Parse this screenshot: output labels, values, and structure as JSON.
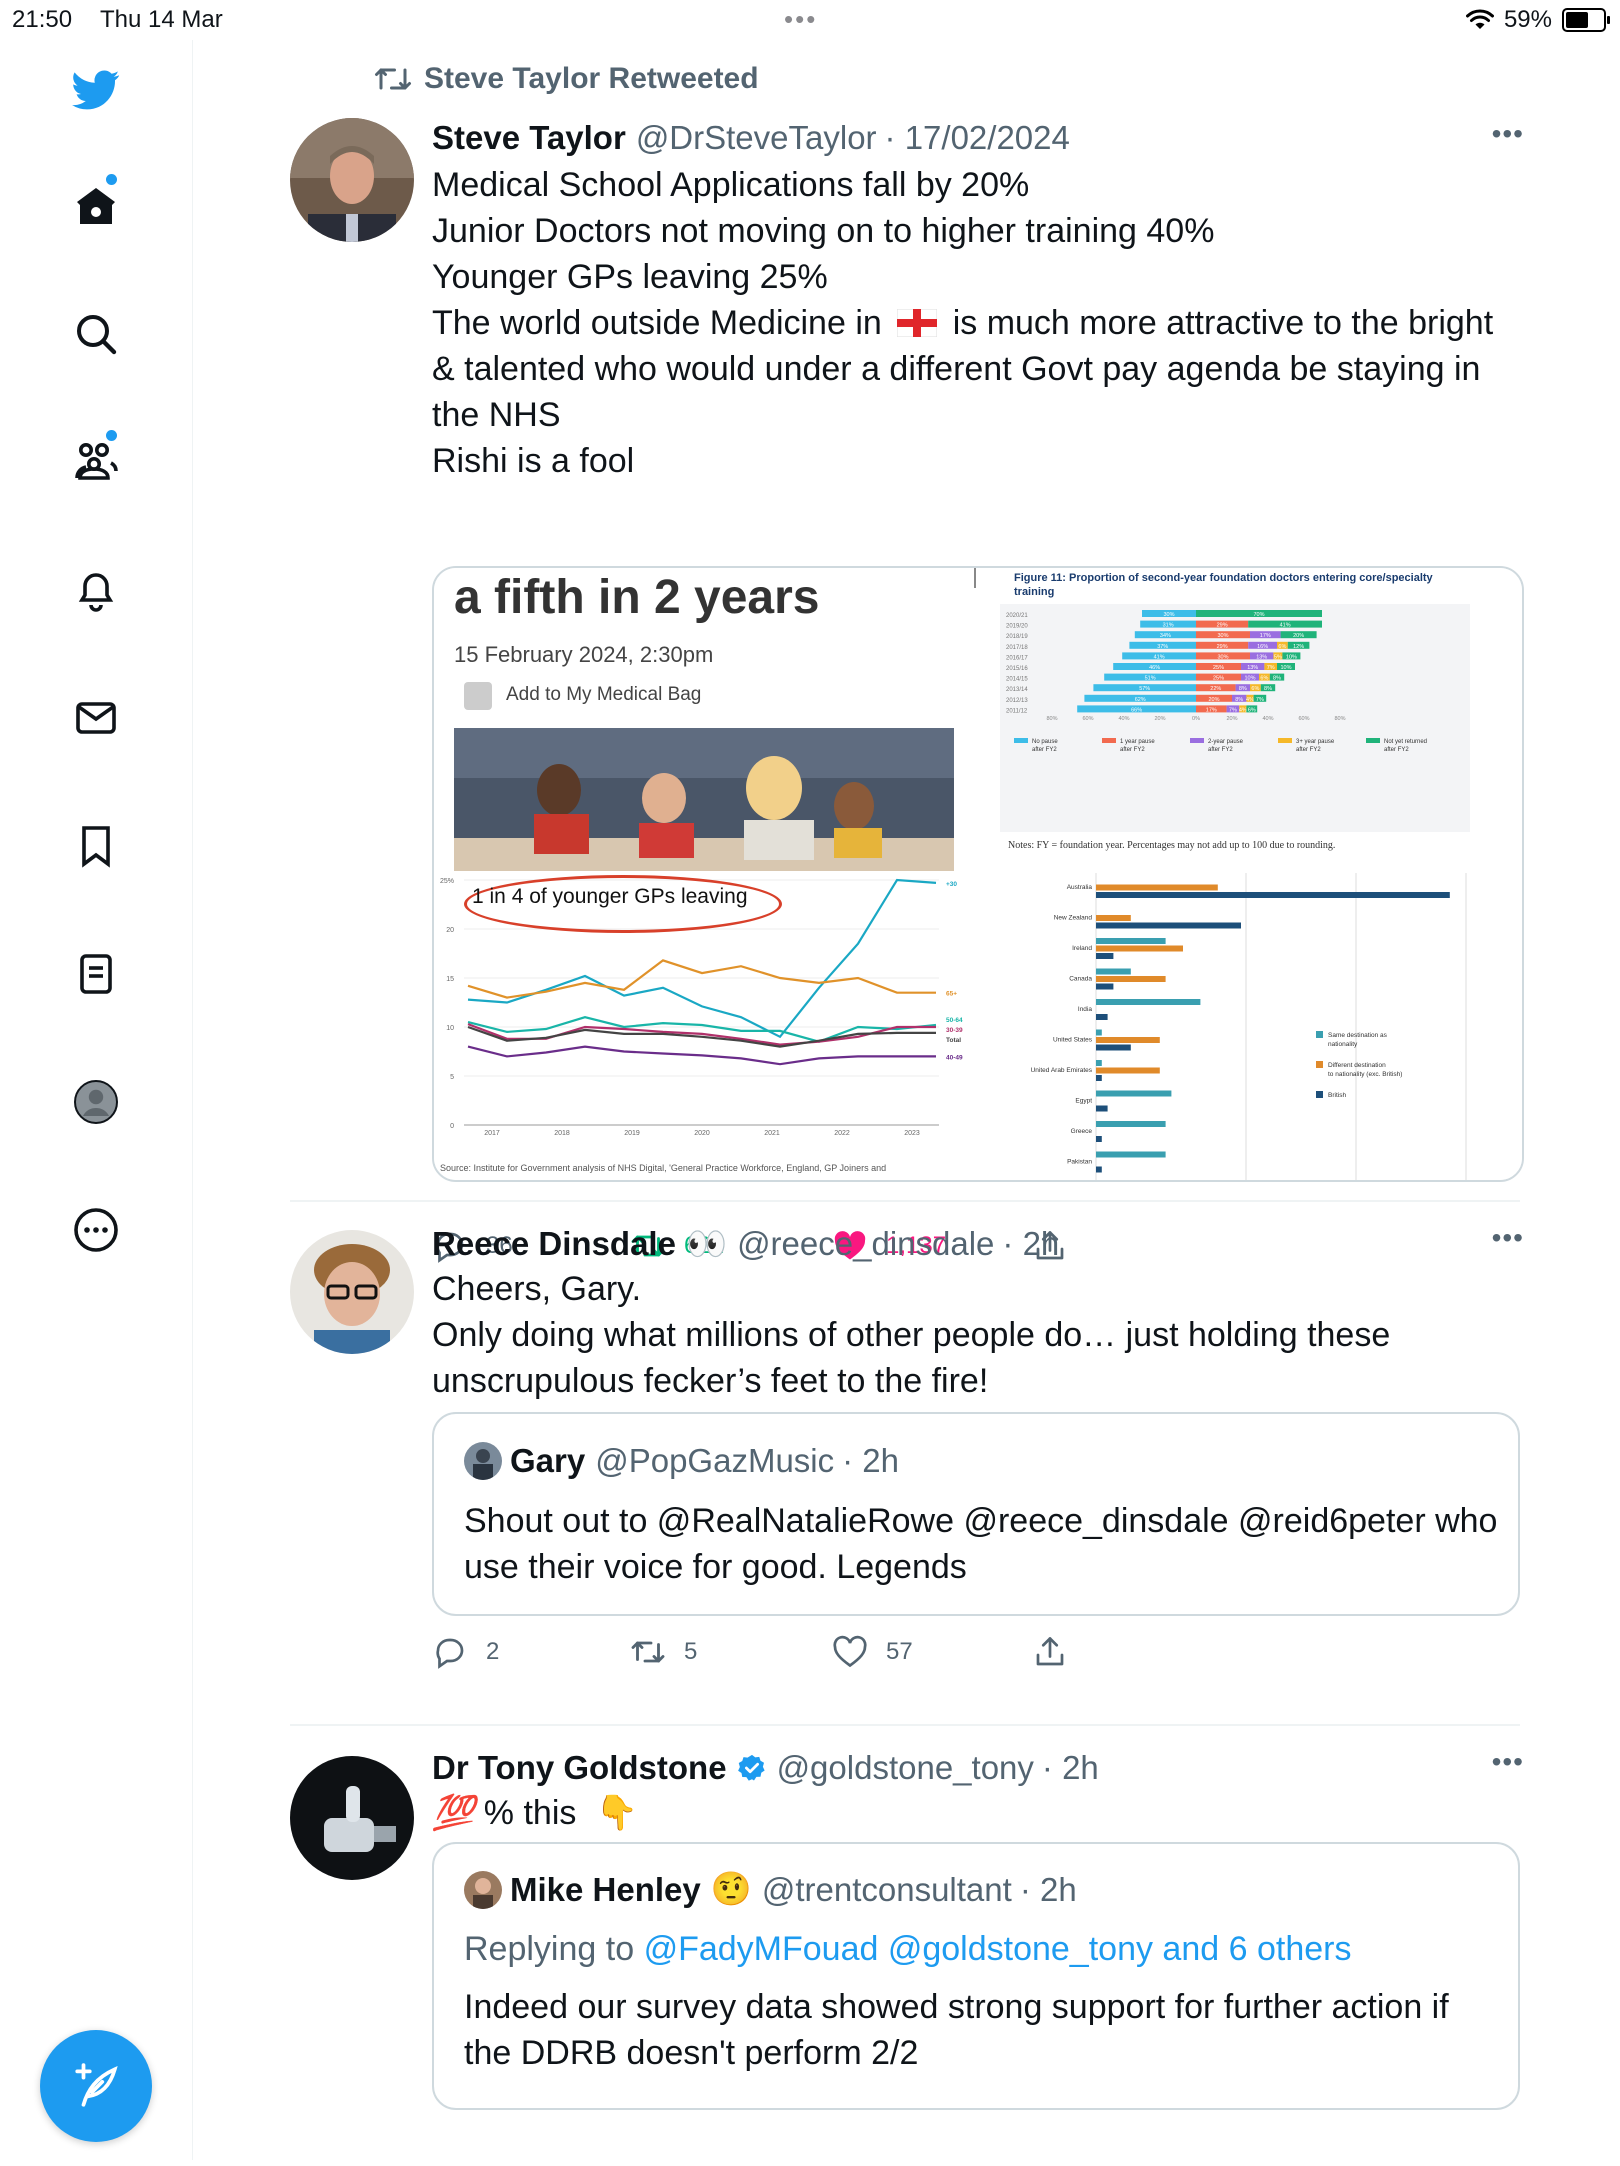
{
  "status_bar": {
    "time": "21:50",
    "date": "Thu 14 Mar",
    "dots": "•••",
    "battery": "59%"
  },
  "colors": {
    "accent": "#1d9bf0",
    "retweet": "#00ba7c",
    "like": "#f91880",
    "secondary": "#536471"
  },
  "sidebar": {
    "icons": [
      "twitter-logo-icon",
      "home-icon",
      "search-icon",
      "communities-icon",
      "notifications-icon",
      "messages-icon",
      "bookmarks-icon",
      "lists-icon",
      "profile-icon",
      "more-icon"
    ]
  },
  "tweets": [
    {
      "retweeted_by": "Steve Taylor Retweeted",
      "name": "Steve Taylor",
      "handle": "@DrSteveTaylor",
      "time": "· 17/02/2024",
      "lines": [
        "Medical School Applications fall by 20%",
        "Junior Doctors not moving on to higher training 40%",
        "Younger GPs leaving 25%",
        "The world outside Medicine in",
        "is much more attractive to the bright",
        "& talented who would under a different Govt pay agenda be staying in",
        "the NHS",
        "Rishi is a fool"
      ],
      "media": {
        "article_heading": "a fifth in 2 years",
        "article_date": "15 February 2024, 2:30pm",
        "article_action": "Add to My Medical Bag",
        "figure_title": "Figure 11: Proportion of second-year foundation doctors entering core/specialty",
        "figure_title_2": "training",
        "figure_notes": "Notes: FY = foundation year. Percentages may not add up to 100 due to rounding.",
        "gp_chart_label": "1 in 4 of younger GPs leaving",
        "gp_chart_source": "Source: Institute for Government analysis of NHS Digital, 'General Practice Workforce, England, GP Joiners and",
        "fig_rows": [
          {
            "year": "2020/21",
            "no_pause": 30,
            "one_year": 0,
            "two_year": 0,
            "three_year": 0,
            "not_returned": 70
          },
          {
            "year": "2019/20",
            "no_pause": 31,
            "one_year": 29,
            "two_year": 0,
            "three_year": 0,
            "not_returned": 41
          },
          {
            "year": "2018/19",
            "no_pause": 34,
            "one_year": 30,
            "two_year": 17,
            "three_year": 0,
            "not_returned": 20
          },
          {
            "year": "2017/18",
            "no_pause": 37,
            "one_year": 29,
            "two_year": 16,
            "three_year": 6,
            "not_returned": 12
          },
          {
            "year": "2016/17",
            "no_pause": 41,
            "one_year": 30,
            "two_year": 13,
            "three_year": 5,
            "not_returned": 10
          },
          {
            "year": "2015/16",
            "no_pause": 46,
            "one_year": 25,
            "two_year": 13,
            "three_year": 7,
            "not_returned": 10
          },
          {
            "year": "2014/15",
            "no_pause": 51,
            "one_year": 25,
            "two_year": 10,
            "three_year": 6,
            "not_returned": 8
          },
          {
            "year": "2013/14",
            "no_pause": 57,
            "one_year": 22,
            "two_year": 8,
            "three_year": 6,
            "not_returned": 8
          },
          {
            "year": "2012/13",
            "no_pause": 62,
            "one_year": 20,
            "two_year": 8,
            "three_year": 4,
            "not_returned": 7
          },
          {
            "year": "2011/12",
            "no_pause": 66,
            "one_year": 17,
            "two_year": 7,
            "three_year": 4,
            "not_returned": 6
          }
        ],
        "fig_axis": [
          "80%",
          "60%",
          "40%",
          "20%",
          "0%",
          "20%",
          "40%",
          "60%",
          "80%"
        ],
        "fig_legend": [
          {
            "label": "No pause after FY2",
            "color": "#3dbde8"
          },
          {
            "label": "1 year pause after FY2",
            "color": "#f26a4f"
          },
          {
            "label": "2-year pause after FY2",
            "color": "#9a6ee0"
          },
          {
            "label": "3+ year pause after FY2",
            "color": "#f5b829"
          },
          {
            "label": "Not yet returned after FY2",
            "color": "#1fb37a"
          }
        ],
        "gp_years": [
          "2017",
          "2018",
          "2019",
          "2020",
          "2021",
          "2022",
          "2023"
        ],
        "gp_yticks": [
          "25%",
          "20",
          "15",
          "10",
          "5",
          "0"
        ],
        "gp_series": [
          {
            "name": "+30",
            "color": "#1aa8c4",
            "values": [
              12.8,
              12.5,
              13.8,
              15.2,
              13.2,
              14,
              12.1,
              11,
              9,
              14,
              18.5,
              25,
              24.7
            ]
          },
          {
            "name": "65+",
            "color": "#e0922a",
            "values": [
              14.2,
              13,
              13.6,
              14.5,
              13.8,
              16.8,
              15.5,
              16.2,
              15,
              14.5,
              15,
              13.5,
              13.5
            ]
          },
          {
            "name": "50-64",
            "color": "#19b5a8",
            "values": [
              10.5,
              9.5,
              9.8,
              11,
              10,
              10.4,
              10.2,
              9.6,
              9.6,
              8.5,
              10,
              9.8,
              10.2
            ]
          },
          {
            "name": "30-39",
            "color": "#b0306a",
            "values": [
              10.3,
              8.8,
              8.8,
              10,
              9.8,
              9.5,
              9.3,
              8.8,
              8.2,
              8.5,
              9,
              10,
              10
            ]
          },
          {
            "name": "Total",
            "color": "#444444",
            "values": [
              10,
              8.6,
              8.9,
              9.7,
              9.3,
              9.3,
              9,
              8.6,
              8,
              8.6,
              9.3,
              9.4,
              9.4
            ]
          },
          {
            "name": "40-49",
            "color": "#6a2d8a",
            "values": [
              8,
              7,
              7.4,
              8,
              7.5,
              7.3,
              7.1,
              6.8,
              6.2,
              6.8,
              7,
              7,
              7
            ]
          }
        ],
        "dest_countries": [
          "Australia",
          "New Zealand",
          "Ireland",
          "Canada",
          "India",
          "United States",
          "United Arab Emirates",
          "Egypt",
          "Greece",
          "Pakistan"
        ],
        "dest_series": [
          {
            "name": "Same destination as nationality",
            "color": "#3a9fb0",
            "values": [
              0,
              0,
              12,
              6,
              18,
              1,
              1,
              13,
              12,
              12
            ]
          },
          {
            "name": "Different destination to nationality (exc. British)",
            "color": "#e08a2a",
            "values": [
              21,
              6,
              15,
              12,
              0,
              11,
              11,
              0,
              0,
              0
            ]
          },
          {
            "name": "British",
            "color": "#1d4f7a",
            "values": [
              61,
              25,
              3,
              3,
              2,
              6,
              1,
              2,
              1,
              1
            ]
          }
        ]
      },
      "replies": "36",
      "retweets": "622",
      "likes": "1,137"
    },
    {
      "name": "Reece Dinsdale",
      "name_emoji": "👀",
      "handle": "@reece_dinsdale",
      "time": "· 2h",
      "lines": [
        "Cheers, Gary.",
        "Only doing what millions of other people do… just holding these",
        "unscrupulous fecker’s feet to the fire!"
      ],
      "quote": {
        "name": "Gary",
        "handle": "@PopGazMusic",
        "time": "· 2h",
        "lines": [
          "Shout out to @RealNatalieRowe @reece_dinsdale @reid6peter who",
          "use their voice for good. Legends"
        ]
      },
      "replies": "2",
      "retweets": "5",
      "likes": "57"
    },
    {
      "name": "Dr Tony Goldstone",
      "handle": "@goldstone_tony",
      "time": "· 2h",
      "line_emoji_start": "💯",
      "line": "% this",
      "line_emoji_end": "👇",
      "quote": {
        "name": "Mike Henley",
        "name_emoji": "🤨",
        "handle": "@trentconsultant",
        "time": "· 2h",
        "replying_prefix": "Replying to",
        "replying_to": "@FadyMFouad @goldstone_tony and 6 others",
        "lines": [
          "Indeed our survey data showed strong support for further action if",
          "the DDRB doesn't perform 2/2"
        ]
      }
    }
  ]
}
